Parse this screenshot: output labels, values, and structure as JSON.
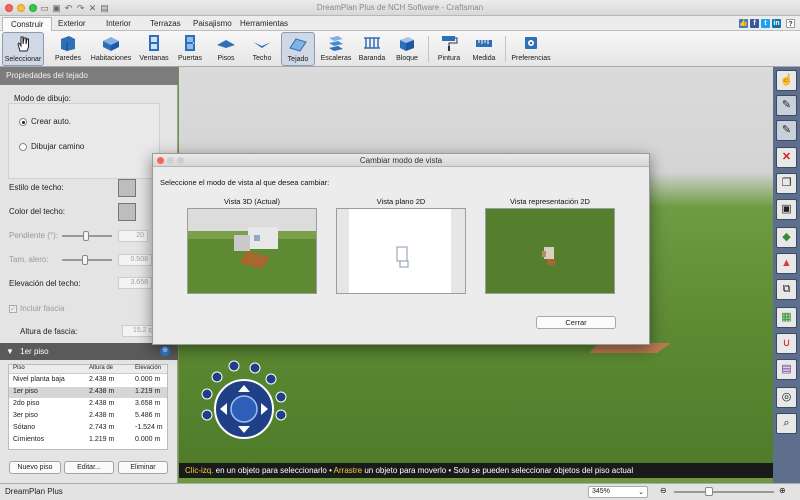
{
  "window": {
    "title": "DreamPlan Plus de NCH Software - Craftsman"
  },
  "menu_tabs": [
    "Construir",
    "Exterior",
    "Interior",
    "Terrazas",
    "Paisajismo",
    "Herramientas"
  ],
  "toolbar": {
    "tools": [
      {
        "label": "Seleccionar",
        "icon": "hand-pointer-icon",
        "selected": true
      },
      {
        "label": "Paredes",
        "icon": "walls-icon"
      },
      {
        "label": "Habitaciones",
        "icon": "rooms-icon"
      },
      {
        "label": "Ventanas",
        "icon": "window-icon"
      },
      {
        "label": "Puertas",
        "icon": "door-icon"
      },
      {
        "label": "Pisos",
        "icon": "floors-icon"
      },
      {
        "label": "Techo",
        "icon": "ceiling-icon"
      },
      {
        "label": "Tejado",
        "icon": "roof-icon",
        "selected": true
      },
      {
        "label": "Escaleras",
        "icon": "stairs-icon"
      },
      {
        "label": "Baranda",
        "icon": "railing-icon"
      },
      {
        "label": "Bloque",
        "icon": "block-icon"
      },
      {
        "label": "Pintura",
        "icon": "paint-roller-icon"
      },
      {
        "label": "Medida",
        "icon": "measure-icon"
      },
      {
        "label": "Preferencias",
        "icon": "preferences-icon"
      }
    ]
  },
  "left_panel": {
    "header": "Propiedades del tejado",
    "draw_mode_label": "Modo de dibujo:",
    "radio_auto": "Crear auto.",
    "radio_path": "Dibujar camino",
    "roof_style_label": "Estilo de techo:",
    "roof_color_label": "Color del techo:",
    "pitch_label": "Pendiente (°):",
    "pitch_value": "20",
    "eave_label": "Tam. alero:",
    "eave_value": "0.508",
    "elevation_label": "Elevación del techo:",
    "elevation_value": "3.658",
    "fascia_checkbox": "Incluir fascia",
    "fascia_height_label": "Altura de fascia:",
    "fascia_height_value": "15.2 c"
  },
  "floors": {
    "header": "1er piso",
    "columns": [
      "Piso",
      "Altura de",
      "Elevación"
    ],
    "rows": [
      {
        "name": "Nivel planta baja",
        "height": "2.438 m",
        "elevation": "0.000 m"
      },
      {
        "name": "1er piso",
        "height": "2.438 m",
        "elevation": "1.219 m",
        "selected": true
      },
      {
        "name": "2do piso",
        "height": "2.438 m",
        "elevation": "3.658 m"
      },
      {
        "name": "3er piso",
        "height": "2.438 m",
        "elevation": "5.486 m"
      },
      {
        "name": "Sótano",
        "height": "2.743 m",
        "elevation": "-1.524 m"
      },
      {
        "name": "Cimientos",
        "height": "1.219 m",
        "elevation": "0.000 m"
      }
    ],
    "buttons": {
      "new": "Nuevo piso",
      "edit": "Editar...",
      "delete": "Eliminar"
    }
  },
  "hint_bar": {
    "part1": "Clic-izq.",
    "part2": " en un objeto para seleccionarlo • ",
    "part3": "Arrastre",
    "part4": " un objeto para moverlo • Solo se pueden seleccionar objetos del piso actual"
  },
  "status": {
    "app_name": "DreamPlan Plus",
    "zoom": "345%"
  },
  "dialog": {
    "title": "Cambiar modo de vista",
    "prompt": "Seleccione el modo de vista al que desea cambiar:",
    "views": [
      {
        "label": "Vista 3D (Actual)"
      },
      {
        "label": "Vista plano 2D"
      },
      {
        "label": "Vista representación 2D"
      }
    ],
    "close_button": "Cerrar"
  },
  "colors": {
    "accent": "#2f7bd6",
    "hint_highlight": "#f2d23c",
    "right_toolbar": "#5d6f8d"
  }
}
